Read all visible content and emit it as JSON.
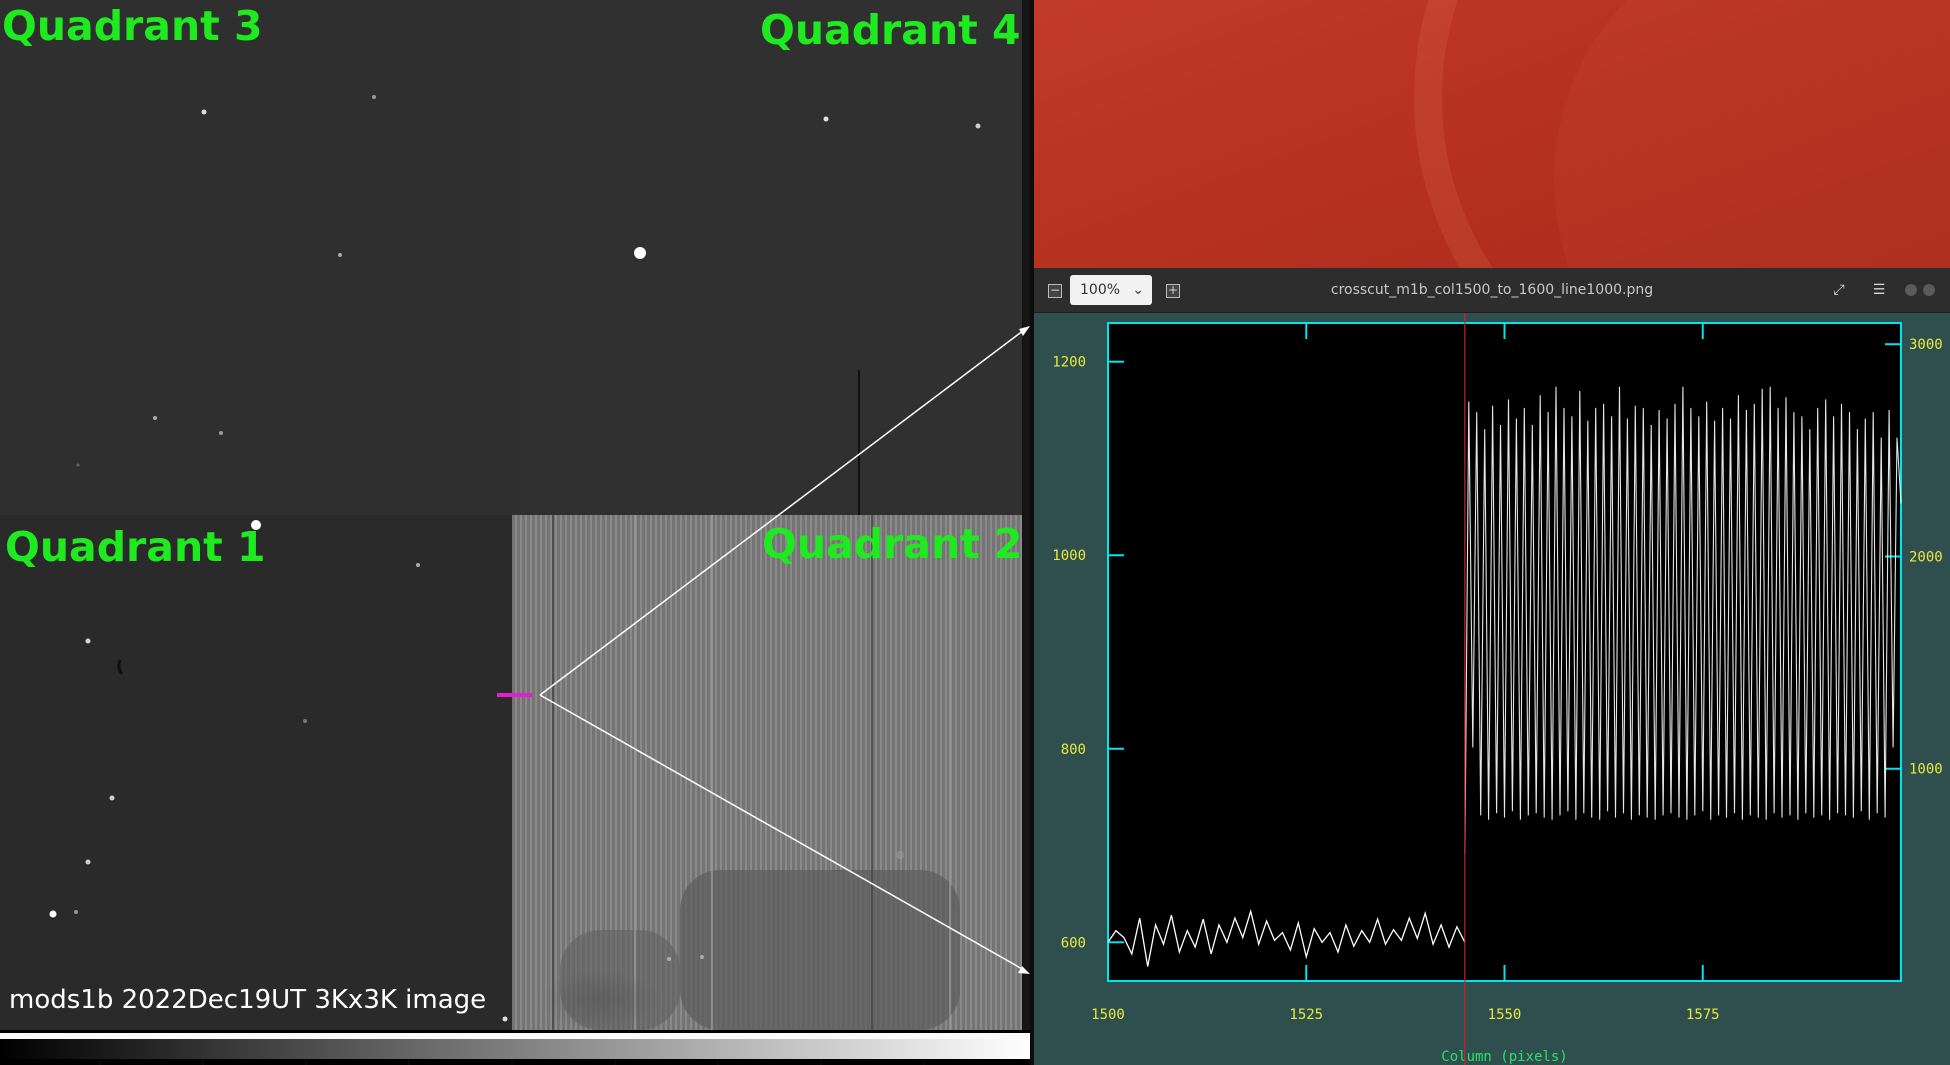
{
  "left_panel": {
    "quadrant_labels": {
      "q1": "Quadrant 1",
      "q2": "Quadrant 2",
      "q3": "Quadrant 3",
      "q4": "Quadrant 4"
    },
    "caption": "mods1b 2022Dec19UT 3Kx3K image",
    "label_color": "#1fea1f",
    "marker_color": "#e020d0"
  },
  "viewer": {
    "zoom_value": "100%",
    "file_title": "crosscut_m1b_col1500_to_1600_line1000.png",
    "icons": {
      "zoom_out": "minus-icon",
      "zoom_select": "chevron-down-icon",
      "zoom_in": "plus-icon",
      "fullscreen": "expand-icon",
      "menu": "hamburger-menu-icon",
      "minimize": "minimize-icon",
      "close": "close-icon"
    }
  },
  "colors": {
    "plot_frame": "#00e5ee",
    "tick_label": "#e8e83c",
    "cursor_line": "#d0202a",
    "plot_background": "#2f4f4f",
    "trace": "#ffffff",
    "desktop": "#b5301f"
  },
  "chart_data": {
    "type": "line",
    "xlabel": "Column (pixels)",
    "xlim": [
      1500,
      1600
    ],
    "x_ticks": [
      1500,
      1525,
      1550,
      1575
    ],
    "ylim_left": [
      560,
      1240
    ],
    "y_ticks_left": [
      600,
      800,
      1000,
      1200
    ],
    "ylim_right": [
      0,
      3100
    ],
    "y_ticks_right": [
      1000,
      2000,
      3000
    ],
    "cursor_x": 1545,
    "grid": false,
    "series": [
      {
        "axis": "left",
        "x": [
          1500,
          1501,
          1502,
          1503,
          1504,
          1505,
          1506,
          1507,
          1508,
          1509,
          1510,
          1511,
          1512,
          1513,
          1514,
          1515,
          1516,
          1517,
          1518,
          1519,
          1520,
          1521,
          1522,
          1523,
          1524,
          1525,
          1526,
          1527,
          1528,
          1529,
          1530,
          1531,
          1532,
          1533,
          1534,
          1535,
          1536,
          1537,
          1538,
          1539,
          1540,
          1541,
          1542,
          1543,
          1544,
          1545
        ],
        "values": [
          600,
          612,
          605,
          588,
          625,
          575,
          618,
          598,
          628,
          590,
          612,
          595,
          624,
          588,
          618,
          600,
          625,
          605,
          632,
          598,
          622,
          602,
          610,
          592,
          620,
          585,
          614,
          600,
          610,
          590,
          618,
          596,
          612,
          600,
          624,
          598,
          613,
          602,
          625,
          604,
          630,
          598,
          618,
          595,
          616,
          600
        ]
      },
      {
        "axis": "right",
        "x": [
          1545,
          1545.5,
          1546,
          1546.5,
          1547,
          1547.5,
          1548,
          1548.5,
          1549,
          1549.5,
          1550,
          1550.5,
          1551,
          1551.5,
          1552,
          1552.5,
          1553,
          1553.5,
          1554,
          1554.5,
          1555,
          1555.5,
          1556,
          1556.5,
          1557,
          1557.5,
          1558,
          1558.5,
          1559,
          1559.5,
          1560,
          1560.5,
          1561,
          1561.5,
          1562,
          1562.5,
          1563,
          1563.5,
          1564,
          1564.5,
          1565,
          1565.5,
          1566,
          1566.5,
          1567,
          1567.5,
          1568,
          1568.5,
          1569,
          1569.5,
          1570,
          1570.5,
          1571,
          1571.5,
          1572,
          1572.5,
          1573,
          1573.5,
          1574,
          1574.5,
          1575,
          1575.5,
          1576,
          1576.5,
          1577,
          1577.5,
          1578,
          1578.5,
          1579,
          1579.5,
          1580,
          1580.5,
          1581,
          1581.5,
          1582,
          1582.5,
          1583,
          1583.5,
          1584,
          1584.5,
          1585,
          1585.5,
          1586,
          1586.5,
          1587,
          1587.5,
          1588,
          1588.5,
          1589,
          1589.5,
          1590,
          1590.5,
          1591,
          1591.5,
          1592,
          1592.5,
          1593,
          1593.5,
          1594,
          1594.5,
          1595,
          1595.5,
          1596,
          1596.5,
          1597,
          1597.5,
          1598,
          1598.5,
          1599,
          1599.5,
          1600
        ],
        "values": [
          600,
          2730,
          1100,
          2680,
          780,
          2600,
          760,
          2710,
          790,
          2620,
          770,
          2740,
          800,
          2650,
          760,
          2700,
          780,
          2620,
          790,
          2760,
          770,
          2680,
          760,
          2800,
          780,
          2700,
          800,
          2660,
          760,
          2780,
          790,
          2640,
          770,
          2700,
          760,
          2720,
          800,
          2660,
          770,
          2800,
          790,
          2650,
          760,
          2710,
          780,
          2700,
          770,
          2620,
          760,
          2690,
          780,
          2650,
          790,
          2720,
          770,
          2800,
          760,
          2700,
          780,
          2660,
          800,
          2730,
          760,
          2640,
          780,
          2700,
          770,
          2650,
          790,
          2760,
          760,
          2690,
          780,
          2720,
          770,
          2790,
          760,
          2800,
          790,
          2700,
          770,
          2750,
          780,
          2680,
          760,
          2660,
          790,
          2600,
          770,
          2700,
          780,
          2740,
          760,
          2660,
          790,
          2720,
          780,
          2680,
          770,
          2600,
          800,
          2650,
          760,
          2680,
          790,
          2560,
          770,
          2690,
          1100,
          2560,
          2250
        ]
      }
    ]
  }
}
